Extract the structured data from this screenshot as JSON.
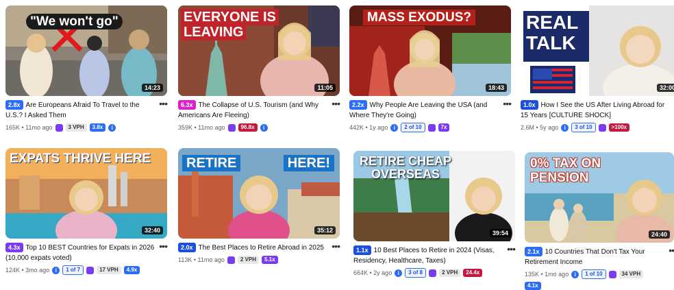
{
  "videos": [
    {
      "overlay": "\"We won't go\"",
      "duration": "14:23",
      "badge": "2.8x",
      "badge_color": "#2d6df6",
      "title": "Are Europeans Afraid To Travel to the U.S.? I Asked Them",
      "views_age": "165K • 11mo ago",
      "vph": "3 VPH",
      "mult": "3.8x"
    },
    {
      "overlay": "EVERYONE IS LEAVING",
      "duration": "11:05",
      "badge": "6.3x",
      "badge_color": "#d624c8",
      "title": "The Collapse of U.S. Tourism (and Why Americans Are Fleeing)",
      "views_age": "359K • 11mo ago",
      "mult": "96.8x"
    },
    {
      "overlay": "MASS EXODUS?",
      "duration": "18:43",
      "badge": "2.2x",
      "badge_color": "#2d6df6",
      "title": "Why People Are Leaving the USA (and Where They're Going)",
      "views_age": "442K • 1y ago",
      "rank": "2 of 10",
      "mult": "7x"
    },
    {
      "overlay": "REAL TALK",
      "duration": "32:00",
      "badge": "1.0x",
      "badge_color": "#1e4fd8",
      "title": "How I See the US After Living Abroad for 15 Years [CULTURE SHOCK]",
      "views_age": "2.6M • 5y ago",
      "rank": "3 of 10",
      "mult": ">100x"
    },
    {
      "overlay": "EXPATS THRIVE HERE",
      "duration": "32:40",
      "badge": "4.3x",
      "badge_color": "#7a3cf0",
      "title": "Top 10 BEST Countries for Expats in 2026 (10,000 expats voted)",
      "views_age": "124K • 3mo ago",
      "rank": "1 of 7",
      "vph": "17 VPH",
      "mult": "4.9x"
    },
    {
      "overlay_left": "RETIRE",
      "overlay_right": "HERE!",
      "duration": "35:12",
      "badge": "2.0x",
      "badge_color": "#1e4fd8",
      "title": "The Best Places to Retire Abroad in 2025",
      "views_age": "113K • 11mo ago",
      "vph": "2 VPH",
      "mult": "5.1x"
    },
    {
      "overlay": "RETIRE CHEAP OVERSEAS",
      "duration": "39:54",
      "badge": "1.1x",
      "badge_color": "#1e4fd8",
      "title": "10 Best Places to Retire in 2024 (Visas, Residency, Healthcare, Taxes)",
      "views_age": "664K • 2y ago",
      "rank": "3 of 8",
      "vph": "2 VPH",
      "mult": "24.4x"
    },
    {
      "overlay": "0% TAX ON PENSION",
      "duration": "24:40",
      "badge": "2.1x",
      "badge_color": "#2d6df6",
      "title": "10 Countries That Don't Tax Your Retirement Income",
      "views_age": "135K • 1mo ago",
      "rank": "1 of 10",
      "vph": "34 VPH",
      "mult": "4.1x"
    }
  ],
  "more_glyph": "•••",
  "info_glyph": "i"
}
